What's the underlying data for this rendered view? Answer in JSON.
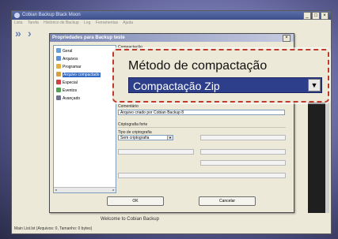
{
  "main_window": {
    "title": "Cobian Backup Black Moon",
    "menu": [
      "Lista",
      "Tarefa",
      "Histórico de Backup",
      "Log",
      "Ferramentas",
      "Ajuda"
    ],
    "controls": [
      "_",
      "□",
      "×"
    ],
    "log_text": "Welcome to Cobian Backup",
    "status": "Main List.lst (Arquivos: 0, Tamanho: 0 bytes)"
  },
  "dialog": {
    "title": "Propriedades para Backup teste",
    "close": "×",
    "tree": [
      {
        "label": "Geral",
        "icon": "general-icon",
        "color": "#6aa0d8"
      },
      {
        "label": "Arquivos",
        "icon": "files-icon",
        "color": "#5b8fd6"
      },
      {
        "label": "Programar",
        "icon": "schedule-icon",
        "color": "#e0b040"
      },
      {
        "label": "Arquivo compactado",
        "icon": "archive-icon",
        "color": "#d6a040",
        "selected": true
      },
      {
        "label": "Especial",
        "icon": "special-icon",
        "color": "#d04040"
      },
      {
        "label": "Eventos",
        "icon": "events-icon",
        "color": "#50a050"
      },
      {
        "label": "Avançado",
        "icon": "advanced-icon",
        "color": "#707090"
      }
    ],
    "compaction_section": "Compactação",
    "comment_label": "Comentário",
    "comment_value": "Arquivo criado por Cobian Backup 8",
    "crypto_section": "Criptografia forte",
    "crypto_type_label": "Tipo de criptografia",
    "crypto_type_value": "Sem criptografia",
    "ok": "OK",
    "cancel": "Cancelar"
  },
  "zoom": {
    "label": "Método de compactação",
    "value": "Compactação Zip",
    "arrow": "▼"
  }
}
